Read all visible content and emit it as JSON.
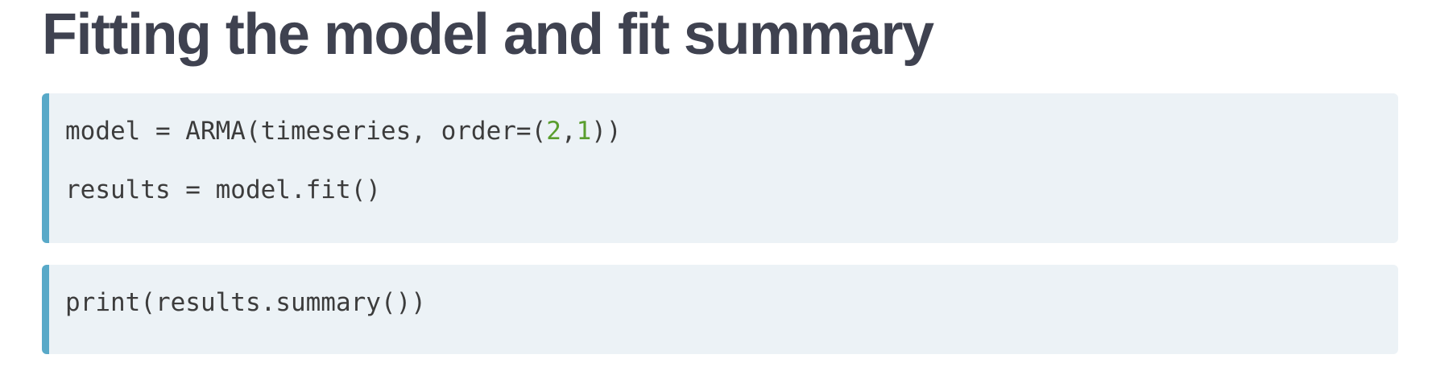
{
  "title": "Fitting the model and fit summary",
  "code_blocks": [
    {
      "lines": [
        {
          "before": "model = ARMA(timeseries, order=(",
          "num1": "2",
          "comma": ",",
          "num2": "1",
          "after": "))"
        },
        {
          "text": "results = model.fit()"
        }
      ]
    },
    {
      "lines": [
        {
          "text": "print(results.summary())"
        }
      ]
    }
  ],
  "colors": {
    "title": "#3f4250",
    "code_background": "#ecf2f6",
    "code_accent_border": "#58a9c8",
    "code_text": "#3c3c3c",
    "number_literal": "#5a9e2e"
  }
}
